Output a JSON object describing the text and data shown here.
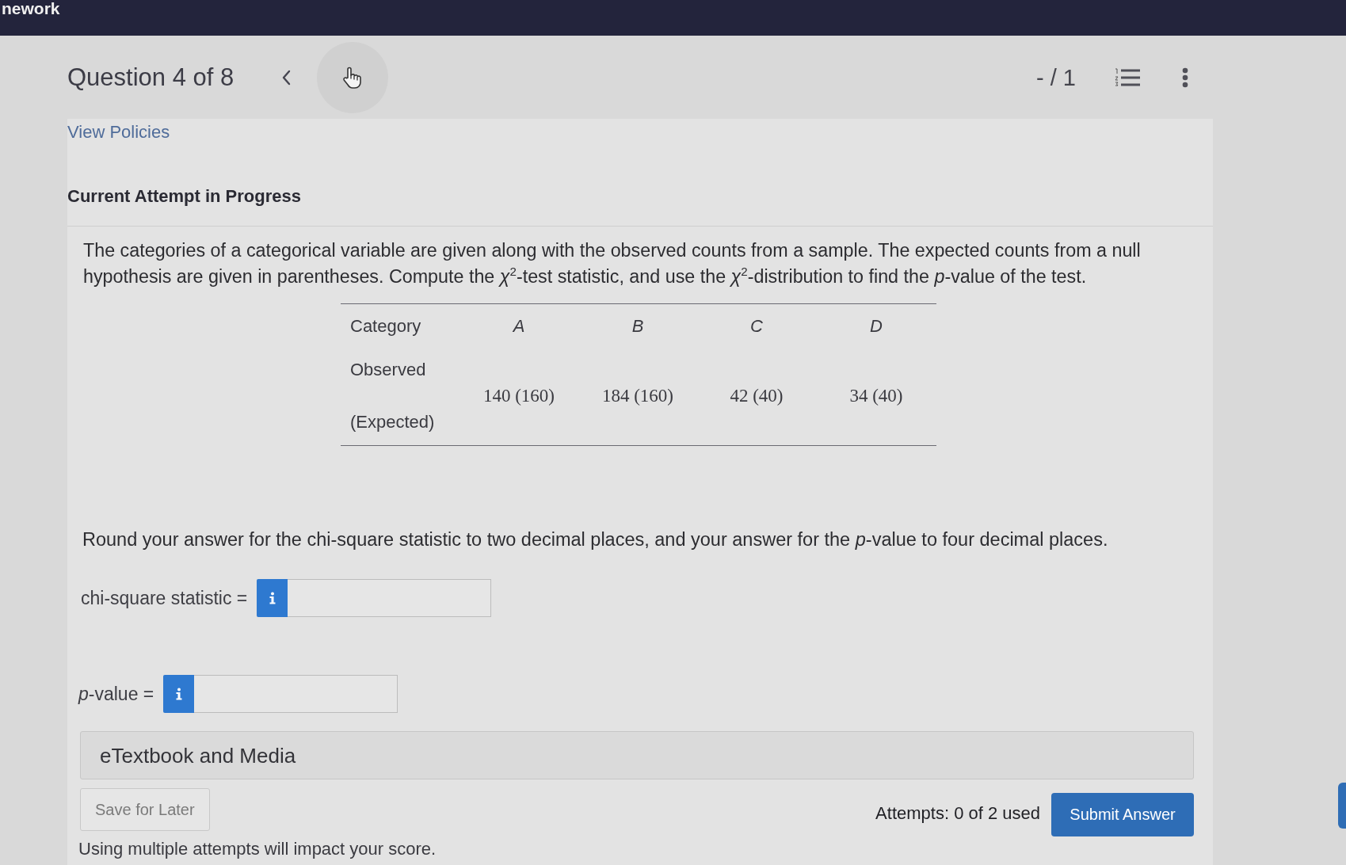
{
  "top_bar": {
    "title": "nework"
  },
  "header": {
    "question": "Question 4 of 8",
    "score": "- / 1"
  },
  "policies_link": "View Policies",
  "attempt_heading": "Current Attempt in Progress",
  "question_text": "The categories of a categorical variable are given along with the observed counts from a sample. The expected counts from a null hypothesis are given in parentheses. Compute the *χ*$^{2}$-test statistic, and use the *χ*$^{2}$-distribution to find the *p*-value of the test.",
  "table": {
    "columns": [
      "Category",
      "A",
      "B",
      "C",
      "D"
    ],
    "row": {
      "labels": [
        "Observed",
        "(Expected)"
      ],
      "cells": [
        "140 (160)",
        "184 (160)",
        "42 (40)",
        "34 (40)"
      ]
    }
  },
  "instructions": "Round your answer for the chi-square statistic to two decimal places, and your answer for the *p*-value to four decimal places.",
  "answers": [
    {
      "label": "chi-square statistic ="
    },
    {
      "label": "*p*-value ="
    }
  ],
  "resources": {
    "title": "eTextbook and Media"
  },
  "footer": {
    "save_button": {
      "label": "Save for Later",
      "disabled": true
    },
    "attempts": "Attempts: 0 of 2 used",
    "submit_button": "Submit Answer",
    "note": "Using multiple attempts will impact your score."
  }
}
